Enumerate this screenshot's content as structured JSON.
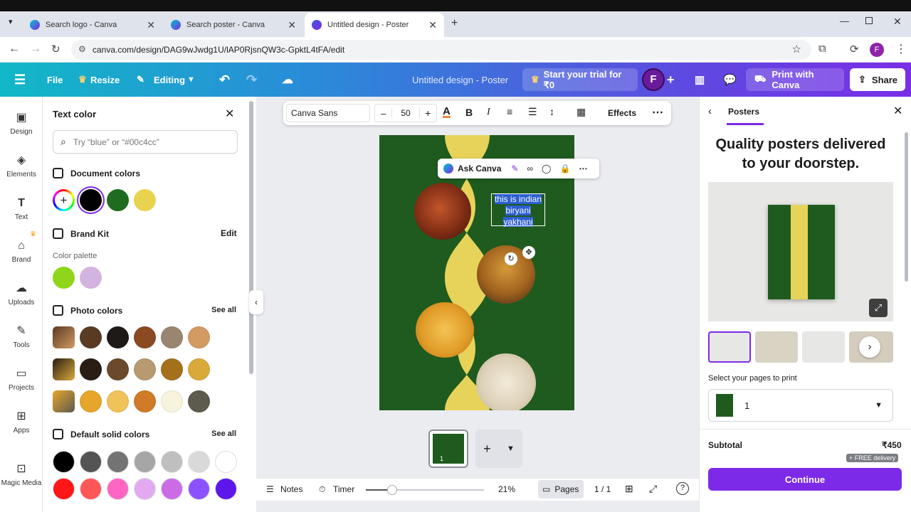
{
  "browser": {
    "tabs": [
      {
        "title": "Search logo - Canva"
      },
      {
        "title": "Search poster - Canva"
      },
      {
        "title": "Untitled design - Poster"
      }
    ],
    "url": "canva.com/design/DAG9wJwdg1U/lAP0RjsnQW3c-GpktL4tFA/edit",
    "profile_initial": "F"
  },
  "header": {
    "file": "File",
    "resize": "Resize",
    "editing": "Editing",
    "title": "Untitled design - Poster",
    "trial": "Start your trial for ₹0",
    "avatar": "F",
    "print": "Print with Canva",
    "share": "Share"
  },
  "rail": [
    {
      "label": "Design",
      "icon": "design-icon"
    },
    {
      "label": "Elements",
      "icon": "elements-icon"
    },
    {
      "label": "Text",
      "icon": "text-icon"
    },
    {
      "label": "Brand",
      "icon": "brand-icon"
    },
    {
      "label": "Uploads",
      "icon": "uploads-icon"
    },
    {
      "label": "Tools",
      "icon": "tools-icon"
    },
    {
      "label": "Projects",
      "icon": "projects-icon"
    },
    {
      "label": "Apps",
      "icon": "apps-icon"
    },
    {
      "label": "Magic Media",
      "icon": "magic-media-icon"
    }
  ],
  "panel": {
    "title": "Text color",
    "search_placeholder": "Try “blue” or “#00c4cc”",
    "document_colors": "Document colors",
    "doc_swatches": [
      "#000000",
      "#1f6b1f",
      "#e8d34f"
    ],
    "brand_kit": "Brand Kit",
    "edit": "Edit",
    "color_palette": "Color palette",
    "palette_swatches": [
      "#8fd61a",
      "#d4b3e0"
    ],
    "photo_colors": "Photo colors",
    "photo_rows": [
      [
        "#5a3a22",
        "#1e1a17",
        "#8b4a22",
        "#9a8670",
        "#d39a62"
      ],
      [
        "#2a1d14",
        "#6a4a2a",
        "#b89a70",
        "#a4701c",
        "#d9a93a"
      ],
      [
        "#e6a52b",
        "#f0c25a",
        "#cf7b27",
        "#f8f3dc",
        "#5d5a4e"
      ]
    ],
    "see_all": "See all",
    "default_solid": "Default solid colors",
    "solid_rows": [
      [
        "#000000",
        "#545454",
        "#737373",
        "#a6a6a6",
        "#bfbfbf",
        "#d9d9d9",
        "#ffffff"
      ],
      [
        "#ff1616",
        "#ff5757",
        "#ff66c4",
        "#e2a9f1",
        "#cb6ce6",
        "#8c52ff",
        "#5e17eb"
      ]
    ]
  },
  "toolbar": {
    "font": "Canva Sans",
    "minus": "–",
    "size": "50",
    "effects": "Effects"
  },
  "context": {
    "ask": "Ask Canva"
  },
  "poster": {
    "text": "this is indian biryani yakhani",
    "bg": "#1f5b1e",
    "wave": "#e8d35a"
  },
  "pages": {
    "thumb_number": "1"
  },
  "bottom": {
    "notes": "Notes",
    "timer": "Timer",
    "zoom": "21%",
    "zoom_level": 0.22,
    "pages": "Pages",
    "page_count": "1 / 1"
  },
  "right": {
    "title": "Posters",
    "headline": "Quality posters delivered to your doorstep.",
    "select_label": "Select your pages to print",
    "selected_page": "1",
    "subtotal_label": "Subtotal",
    "subtotal_value": "₹450",
    "free": "+ FREE delivery",
    "continue": "Continue"
  }
}
